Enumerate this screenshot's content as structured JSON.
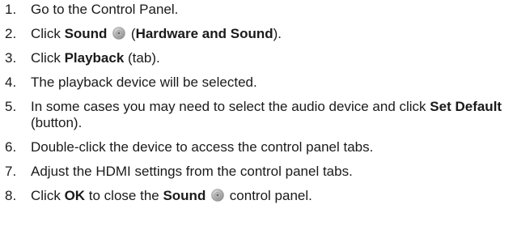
{
  "steps": [
    {
      "num": "1.",
      "parts": [
        {
          "t": "Go to the Control Panel."
        }
      ]
    },
    {
      "num": "2.",
      "parts": [
        {
          "t": "Click "
        },
        {
          "t": "Sound",
          "b": true
        },
        {
          "t": " "
        },
        {
          "icon": "speaker-icon"
        },
        {
          "t": " ("
        },
        {
          "t": "Hardware and Sound",
          "b": true
        },
        {
          "t": ")."
        }
      ]
    },
    {
      "num": "3.",
      "parts": [
        {
          "t": "Click "
        },
        {
          "t": "Playback",
          "b": true
        },
        {
          "t": " (tab)."
        }
      ]
    },
    {
      "num": "4.",
      "parts": [
        {
          "t": "The playback device will be selected."
        }
      ]
    },
    {
      "num": "5.",
      "parts": [
        {
          "t": "In some cases you may need to select the audio device and click "
        },
        {
          "t": "Set Default",
          "b": true
        },
        {
          "t": " (button)."
        }
      ]
    },
    {
      "num": "6.",
      "parts": [
        {
          "t": "Double-click the device to access the control panel tabs."
        }
      ]
    },
    {
      "num": "7.",
      "parts": [
        {
          "t": "Adjust the HDMI settings from the control panel tabs."
        }
      ]
    },
    {
      "num": "8.",
      "parts": [
        {
          "t": "Click "
        },
        {
          "t": "OK",
          "b": true
        },
        {
          "t": " to close the "
        },
        {
          "t": "Sound",
          "b": true
        },
        {
          "t": " "
        },
        {
          "icon": "speaker-icon"
        },
        {
          "t": " control panel."
        }
      ]
    }
  ],
  "colors": {
    "text": "#1a1a1a",
    "icon_light": "#e6e6e6",
    "icon_dark": "#8a8a8a"
  }
}
